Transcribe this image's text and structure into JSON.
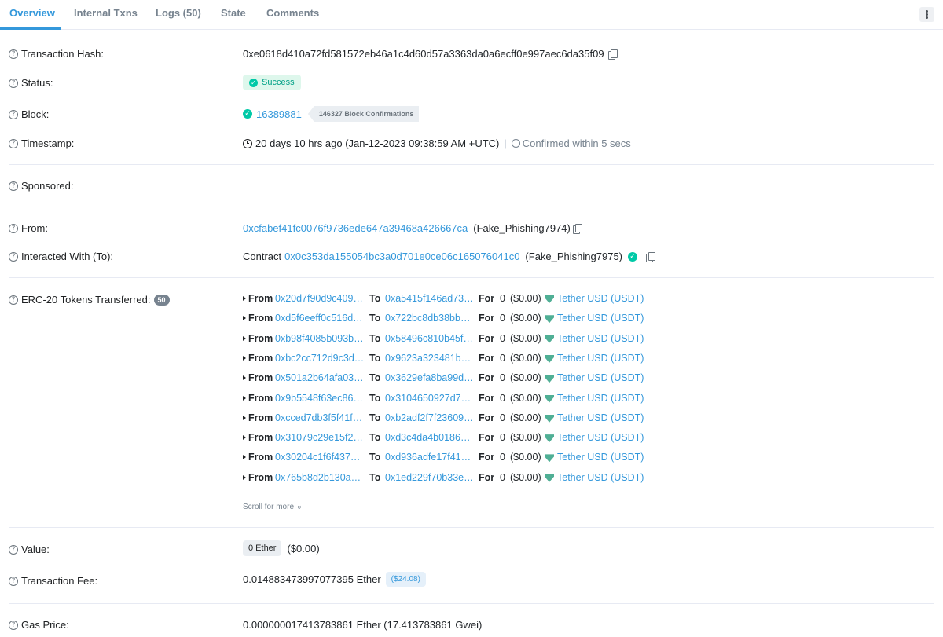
{
  "tabs": [
    {
      "label": "Overview",
      "active": true
    },
    {
      "label": "Internal Txns",
      "active": false
    },
    {
      "label": "Logs (50)",
      "active": false
    },
    {
      "label": "State",
      "active": false
    },
    {
      "label": "Comments",
      "active": false
    }
  ],
  "labels": {
    "tx_hash": "Transaction Hash:",
    "status": "Status:",
    "block": "Block:",
    "timestamp": "Timestamp:",
    "sponsored": "Sponsored:",
    "from": "From:",
    "interacted": "Interacted With (To):",
    "erc20": "ERC-20 Tokens Transferred:",
    "value": "Value:",
    "fee": "Transaction Fee:",
    "gas": "Gas Price:"
  },
  "help_glyph": "?",
  "tx_hash": "0xe0618d410a72fd581572eb46a1c4d60d57a3363da0a6ecff0e997aec6da35f09",
  "status": {
    "check": "✓",
    "text": "Success",
    "color": "#00a186"
  },
  "block": {
    "check": "✓",
    "number": "16389881",
    "confirmations": "146327 Block Confirmations"
  },
  "timestamp": {
    "age": "20 days 10 hrs ago (Jan-12-2023 09:38:59 AM +UTC)",
    "separator": "|",
    "confirmed": "Confirmed within 5 secs"
  },
  "from": {
    "address": "0xcfabef41fc0076f9736ede647a39468a426667ca",
    "name": "(Fake_Phishing7974)"
  },
  "interacted": {
    "prefix": "Contract",
    "address": "0x0c353da155054bc3a0d701e0ce06c165076041c0",
    "name": "(Fake_Phishing7975)",
    "check": "✓"
  },
  "erc20": {
    "count": "50",
    "from_label": "From",
    "to_label": "To",
    "for_label": "For",
    "transfers": [
      {
        "from": "0x20d7f90d9c409…",
        "to": "0xa5415f146ad73…",
        "amount": "0",
        "usd": "($0.00)",
        "token": "Tether USD (USDT)"
      },
      {
        "from": "0xd5f6eeff0c516d…",
        "to": "0x722bc8db38bbd…",
        "amount": "0",
        "usd": "($0.00)",
        "token": "Tether USD (USDT)"
      },
      {
        "from": "0xb98f4085b093b…",
        "to": "0x58496c810b45f…",
        "amount": "0",
        "usd": "($0.00)",
        "token": "Tether USD (USDT)"
      },
      {
        "from": "0xbc2cc712d9c3d…",
        "to": "0x9623a323481b8…",
        "amount": "0",
        "usd": "($0.00)",
        "token": "Tether USD (USDT)"
      },
      {
        "from": "0x501a2b64afa03…",
        "to": "0x3629efa8ba99d…",
        "amount": "0",
        "usd": "($0.00)",
        "token": "Tether USD (USDT)"
      },
      {
        "from": "0x9b5548f63ec86…",
        "to": "0x3104650927d7c…",
        "amount": "0",
        "usd": "($0.00)",
        "token": "Tether USD (USDT)"
      },
      {
        "from": "0xcced7db3f5f41f…",
        "to": "0xb2adf2f7f23609…",
        "amount": "0",
        "usd": "($0.00)",
        "token": "Tether USD (USDT)"
      },
      {
        "from": "0x31079c29e15f2…",
        "to": "0xd3c4da4b01864…",
        "amount": "0",
        "usd": "($0.00)",
        "token": "Tether USD (USDT)"
      },
      {
        "from": "0x30204c1f6f4374…",
        "to": "0xd936adfe17f41d…",
        "amount": "0",
        "usd": "($0.00)",
        "token": "Tether USD (USDT)"
      },
      {
        "from": "0x765b8d2b130a6…",
        "to": "0x1ed229f70b33e…",
        "amount": "0",
        "usd": "($0.00)",
        "token": "Tether USD (USDT)"
      }
    ],
    "scroll_more": "Scroll for more",
    "scroll_chevron": "»",
    "token_color": "#50af95"
  },
  "value": {
    "ether": "0 Ether",
    "usd": "($0.00)"
  },
  "fee": {
    "ether": "0.014883473997077395 Ether",
    "usd": "($24.08)"
  },
  "gas": {
    "price": "0.000000017413783861 Ether (17.413783861 Gwei)"
  },
  "icons": {
    "kebab": "more-vertical-icon",
    "copy": "copy-icon",
    "clock": "clock-icon",
    "timer": "timer-icon",
    "tether": "tether-icon"
  },
  "colors": {
    "link": "#3498db",
    "success_bg": "#def7ec",
    "muted": "#77838f"
  }
}
